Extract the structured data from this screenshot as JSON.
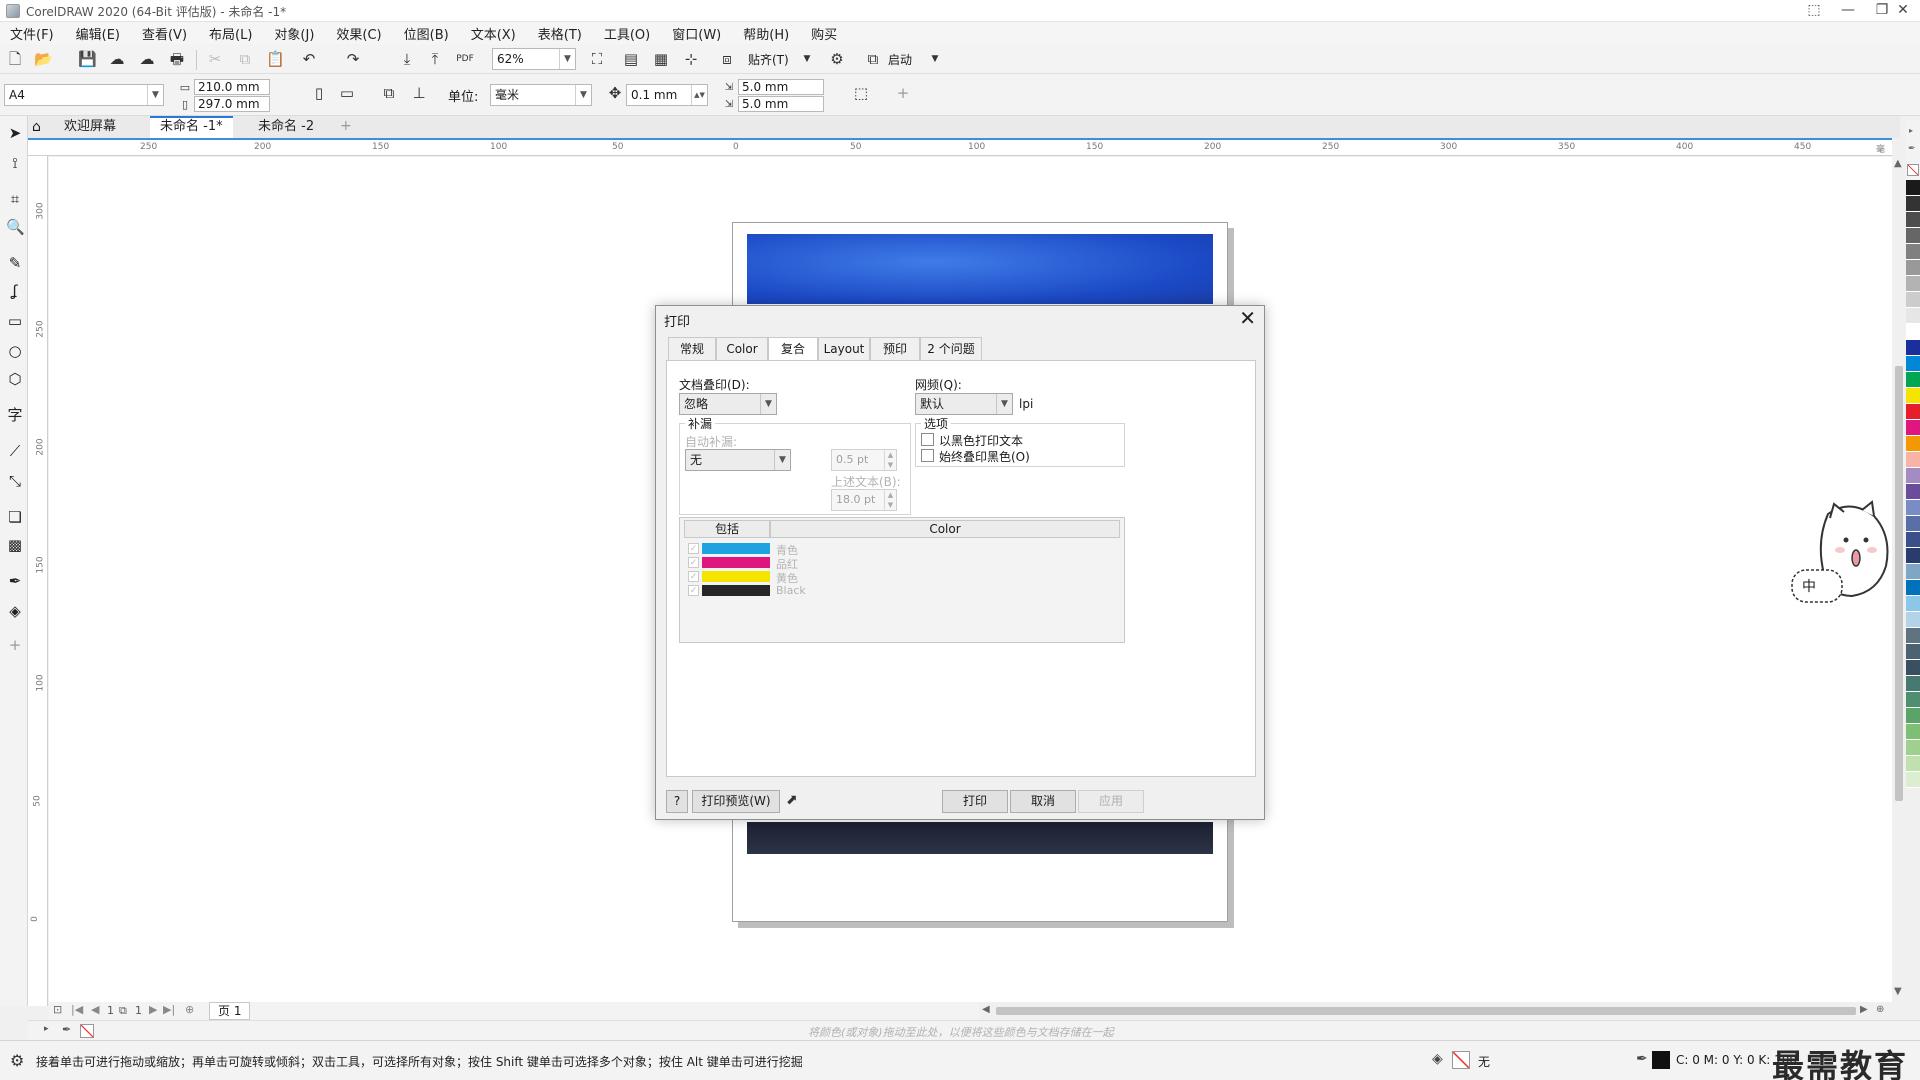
{
  "window": {
    "title": "CorelDRAW 2020 (64-Bit 评估版) - 未命名 -1*"
  },
  "menu": [
    "文件(F)",
    "编辑(E)",
    "查看(V)",
    "布局(L)",
    "对象(J)",
    "效果(C)",
    "位图(B)",
    "文本(X)",
    "表格(T)",
    "工具(O)",
    "窗口(W)",
    "帮助(H)",
    "购买"
  ],
  "toolbar": {
    "zoom": "62%",
    "snap_label": "贴齐(T)",
    "launch_label": "启动"
  },
  "propbar": {
    "page_size": "A4",
    "width": "210.0 mm",
    "height": "297.0 mm",
    "units_label": "单位:",
    "units_value": "毫米",
    "nudge": "0.1 mm",
    "dup_x": "5.0 mm",
    "dup_y": "5.0 mm"
  },
  "doc_tabs": {
    "home": "欢迎屏幕",
    "tab1": "未命名 -1*",
    "tab2": "未命名 -2"
  },
  "ruler": {
    "h_ticks": [
      "250",
      "200",
      "150",
      "100",
      "50",
      "0",
      "50",
      "100",
      "150",
      "200",
      "250",
      "300",
      "350",
      "400",
      "450"
    ],
    "unit": "毫米",
    "v_ticks": [
      "300",
      "250",
      "200",
      "150",
      "100",
      "50",
      "0"
    ]
  },
  "dialog": {
    "title": "打印",
    "tabs": [
      "常规",
      "Color",
      "复合",
      "Layout",
      "预印",
      "2 个问题"
    ],
    "doc_overprint_label": "文档叠印(D):",
    "doc_overprint_value": "忽略",
    "screen_freq_label": "网频(Q):",
    "screen_freq_value": "默认",
    "lpi": "lpi",
    "trap_group": "补漏",
    "auto_trap_label": "自动补漏:",
    "auto_trap_value": "无",
    "trap_width": "0.5 pt",
    "above_text_label": "上述文本(B):",
    "above_text_value": "18.0 pt",
    "options_group": "选项",
    "opt1": "以黑色打印文本",
    "opt2": "始终叠印黑色(O)",
    "table_headers": [
      "包括",
      "Color"
    ],
    "plates": [
      {
        "name": "青色",
        "color": "#1fa2e0"
      },
      {
        "name": "品红",
        "color": "#e0167f"
      },
      {
        "name": "黄色",
        "color": "#f5e400"
      },
      {
        "name": "Black",
        "color": "#262626"
      }
    ],
    "help_btn": "?",
    "preview_btn": "打印预览(W)",
    "print_btn": "打印",
    "cancel_btn": "取消",
    "apply_btn": "应用"
  },
  "page_nav": {
    "current": "1",
    "total": "1",
    "page_tab": "页 1"
  },
  "colorbar_hint": "将颜色(或对象)拖动至此处，以便将这些颜色与文档存储在一起",
  "status": {
    "message": "接着单击可进行拖动或缩放；再单击可旋转或倾斜；双击工具，可选择所有对象；按住 Shift 键单击可选择多个对象；按住 Alt 键单击可进行挖掘",
    "fill_label": "无",
    "cmyk": "C: 0 M: 0 Y: 0 K: 100"
  },
  "watermark": "最需教育",
  "mascot_text": "中",
  "palette": [
    "#1a1a1a",
    "#333333",
    "#4d4d4d",
    "#666666",
    "#808080",
    "#999999",
    "#b3b3b3",
    "#cccccc",
    "#e6e6e6",
    "#ffffff",
    "#1b2f9c",
    "#0088d6",
    "#00a651",
    "#f5e400",
    "#e61d2b",
    "#e0167f",
    "#f39800",
    "#f7b3a5",
    "#a58bc4",
    "#6b4c9a",
    "#7a8cc6",
    "#5a6ea8",
    "#3b4f8a",
    "#2a3b6e",
    "#7fa6c4",
    "#0071bc",
    "#8cc6e8",
    "#b3d4e8",
    "#5f7480",
    "#4b6370",
    "#3a5060",
    "#467a70",
    "#4f8f6f",
    "#5aa46a",
    "#7cbf75",
    "#9fd090",
    "#c0e0b0",
    "#dbeed0"
  ]
}
